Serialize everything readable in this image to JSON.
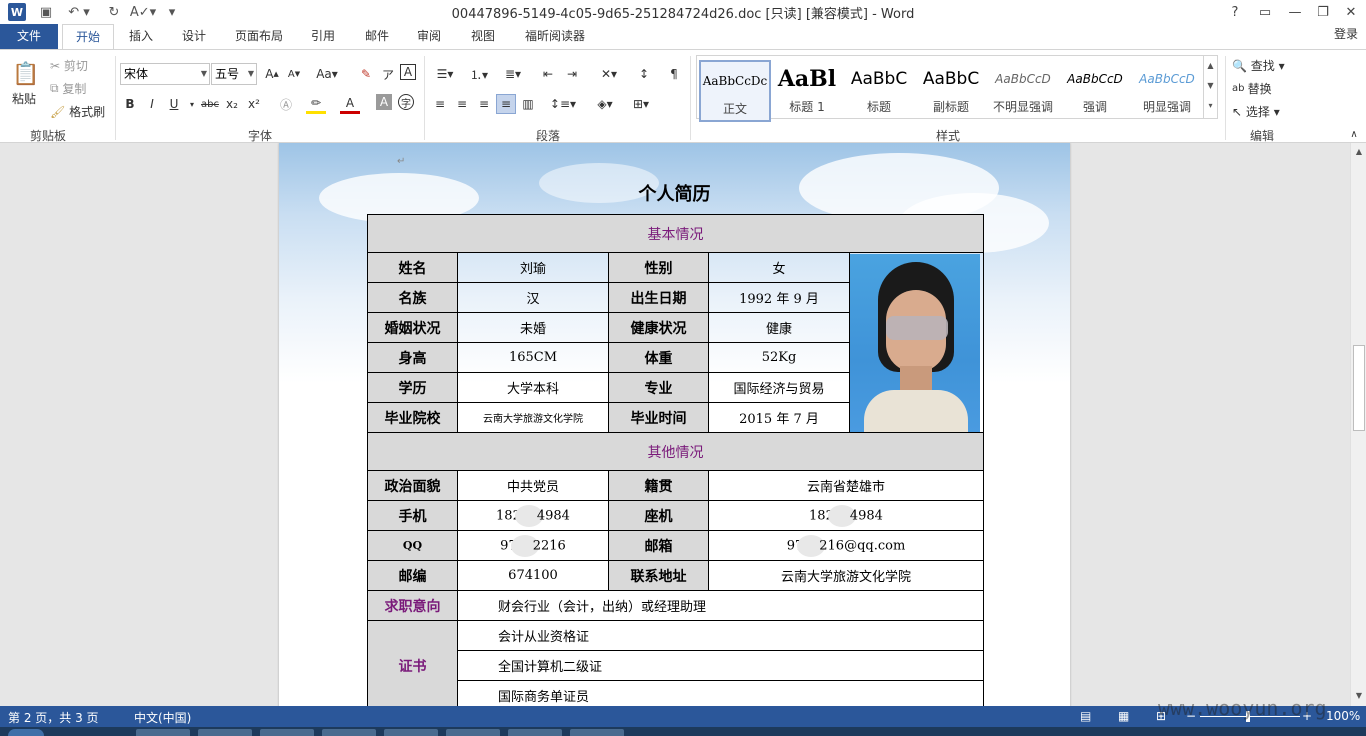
{
  "titlebar": {
    "title": "00447896-5149-4c05-9d65-251284724d26.doc [只读] [兼容模式] - Word",
    "logo": "W",
    "help": "?"
  },
  "tabs": [
    "文件",
    "开始",
    "插入",
    "设计",
    "页面布局",
    "引用",
    "邮件",
    "审阅",
    "视图",
    "福昕阅读器"
  ],
  "login": "登录",
  "clipboard": {
    "paste": "粘贴",
    "cut": "剪切",
    "copy": "复制",
    "format_painter": "格式刷",
    "label": "剪贴板"
  },
  "font": {
    "name": "宋体",
    "size": "五号",
    "label": "字体",
    "bold": "B",
    "italic": "I",
    "underline": "U",
    "strike": "abc",
    "sub": "x₂",
    "sup": "x²",
    "grow": "A",
    "shrink": "A",
    "aa": "Aa",
    "wen": "文",
    "A": "A"
  },
  "paragraph": {
    "label": "段落"
  },
  "styles": {
    "label": "样式",
    "items": [
      {
        "preview": "AaBbCcDc",
        "name": "正文"
      },
      {
        "preview": "AaBl",
        "name": "标题 1"
      },
      {
        "preview": "AaBbC",
        "name": "标题"
      },
      {
        "preview": "AaBbC",
        "name": "副标题"
      },
      {
        "preview": "AaBbCcD",
        "name": "不明显强调"
      },
      {
        "preview": "AaBbCcD",
        "name": "强调"
      },
      {
        "preview": "AaBbCcD",
        "name": "明显强调"
      }
    ]
  },
  "editing": {
    "label": "编辑",
    "find": "查找",
    "replace": "替换",
    "select": "选择"
  },
  "document": {
    "title": "个人简历",
    "section_basic": "基本情况",
    "section_other": "其他情况",
    "basic": [
      {
        "l1": "姓名",
        "v1": "刘瑜",
        "l2": "性别",
        "v2": "女"
      },
      {
        "l1": "名族",
        "v1": "汉",
        "l2": "出生日期",
        "v2": "1992 年 9 月"
      },
      {
        "l1": "婚姻状况",
        "v1": "未婚",
        "l2": "健康状况",
        "v2": "健康"
      },
      {
        "l1": "身高",
        "v1": "165CM",
        "l2": "体重",
        "v2": "52Kg"
      },
      {
        "l1": "学历",
        "v1": "大学本科",
        "l2": "专业",
        "v2": "国际经济与贸易"
      },
      {
        "l1": "毕业院校",
        "v1": "云南大学旅游文化学院",
        "l2": "毕业时间",
        "v2": "2015 年 7 月"
      }
    ],
    "other": [
      {
        "l1": "政治面貌",
        "v1": "中共党员",
        "l2": "籍贯",
        "v2": "云南省楚雄市"
      },
      {
        "l1": "手机",
        "v1a": "182",
        "v1b": "4984",
        "l2": "座机",
        "v2a": "182",
        "v2b": "4984"
      },
      {
        "l1": "QQ",
        "v1a": "97",
        "v1b": "2216",
        "l2": "邮箱",
        "v2a": "97",
        "v2b": "216@qq.com"
      },
      {
        "l1": "邮编",
        "v1": "674100",
        "l2": "联系地址",
        "v2": "云南大学旅游文化学院"
      }
    ],
    "objective_label": "求职意向",
    "objective": "财会行业（会计，出纳）或经理助理",
    "cert_label": "证书",
    "certs": [
      "会计从业资格证",
      "全国计算机二级证",
      "国际商务单证员"
    ],
    "para_mark": "↵"
  },
  "status": {
    "page": "第 2 页，共 3 页",
    "lang": "中文(中国)",
    "zoom": "100%"
  },
  "watermark": "www.wooyun.org",
  "colors": {
    "accent": "#2b579a",
    "section_text": "#7a1a7a",
    "header_fill": "#d9d9d9"
  }
}
